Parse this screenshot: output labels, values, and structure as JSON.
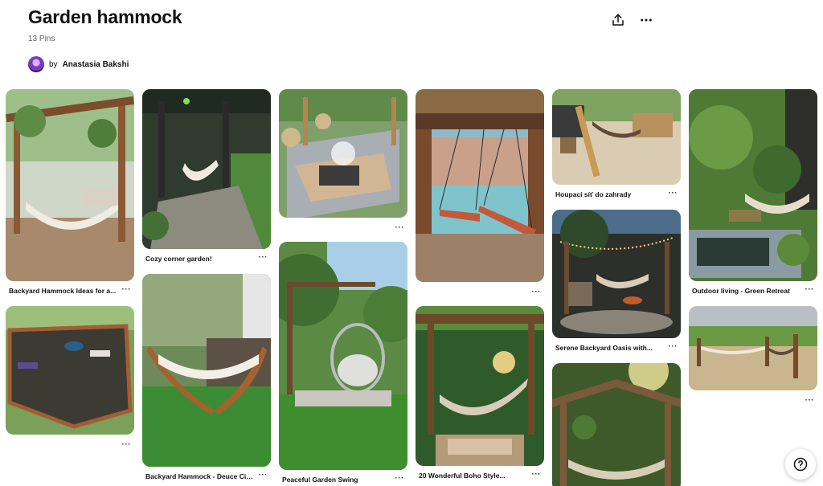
{
  "board": {
    "title": "Garden hammock",
    "pin_count": "13 Pins",
    "by_label": "by",
    "owner_name": "Anastasia Bakshi"
  },
  "header_actions": {
    "share_icon": "share-icon",
    "more_icon": "more-horizontal-icon"
  },
  "pins": {
    "p1": {
      "title": "Backyard Hammock Ideas for a...",
      "more": "···"
    },
    "p2": {
      "title": "",
      "more": "···"
    },
    "p3": {
      "title": "Cozy corner garden!",
      "more": "···"
    },
    "p4": {
      "title": "Backyard Hammock - Deuce Citi...",
      "more": "···"
    },
    "p5": {
      "title": "",
      "more": "···"
    },
    "p6": {
      "title": "Peaceful Garden Swing",
      "more": "···"
    },
    "p7": {
      "title": "",
      "more": "···"
    },
    "p8": {
      "title": "20 Wonderful Boho Style...",
      "more": "···"
    },
    "p9": {
      "title": "Houpací síť do zahrady",
      "more": "···"
    },
    "p10": {
      "title": "Serene Backyard Oasis with...",
      "more": "···"
    },
    "p11": {
      "title": "",
      "more": ""
    },
    "p12": {
      "title": "Outdoor living - Green Retreat",
      "more": "···"
    },
    "p13": {
      "title": "",
      "more": "···"
    }
  },
  "help": {
    "label": "?"
  },
  "colors": {
    "text": "#111111",
    "muted": "#5f5f5f",
    "accent": "#e60023"
  }
}
